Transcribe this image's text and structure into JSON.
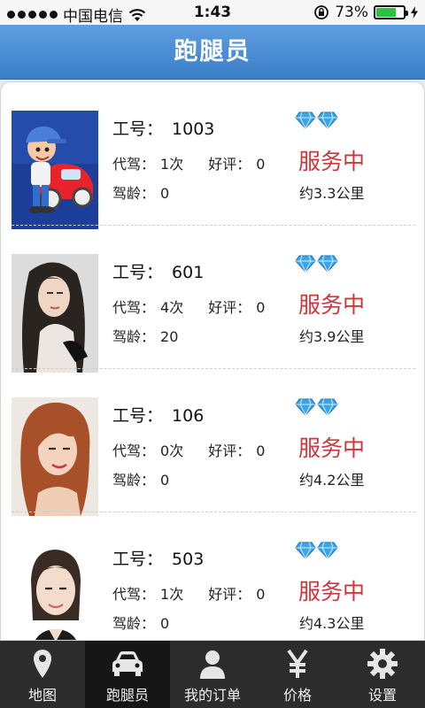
{
  "status_bar": {
    "carrier": "中国电信",
    "time": "1:43",
    "battery_percent": "73%",
    "battery_level": 0.73
  },
  "header": {
    "title": "跑腿员"
  },
  "labels": {
    "id": "工号：",
    "drives": "代驾：",
    "rating": "好评：",
    "experience": "驾龄："
  },
  "runners": [
    {
      "id": "1003",
      "drives": "1次",
      "rating": "0",
      "experience": "0",
      "status": "服务中",
      "distance": "约3.3公里",
      "diamonds": 2,
      "avatar": "cartoon-driver"
    },
    {
      "id": "601",
      "drives": "4次",
      "rating": "0",
      "experience": "20",
      "status": "服务中",
      "distance": "约3.9公里",
      "diamonds": 2,
      "avatar": "woman-long-dark-hair"
    },
    {
      "id": "106",
      "drives": "0次",
      "rating": "0",
      "experience": "0",
      "status": "服务中",
      "distance": "约4.2公里",
      "diamonds": 2,
      "avatar": "woman-auburn-hair"
    },
    {
      "id": "503",
      "drives": "1次",
      "rating": "0",
      "experience": "0",
      "status": "服务中",
      "distance": "约4.3公里",
      "diamonds": 2,
      "avatar": "woman-id-photo"
    }
  ],
  "tabs": [
    {
      "label": "地图",
      "icon": "map-pin-icon",
      "active": false
    },
    {
      "label": "跑腿员",
      "icon": "car-icon",
      "active": true
    },
    {
      "label": "我的订单",
      "icon": "user-icon",
      "active": false
    },
    {
      "label": "价格",
      "icon": "yen-icon",
      "active": false
    },
    {
      "label": "设置",
      "icon": "gear-icon",
      "active": false
    }
  ],
  "colors": {
    "header_blue": "#3a7ec8",
    "status_red": "#d0353c",
    "tab_bar": "#2c2c2c",
    "diamond": "#3aa6e8"
  }
}
